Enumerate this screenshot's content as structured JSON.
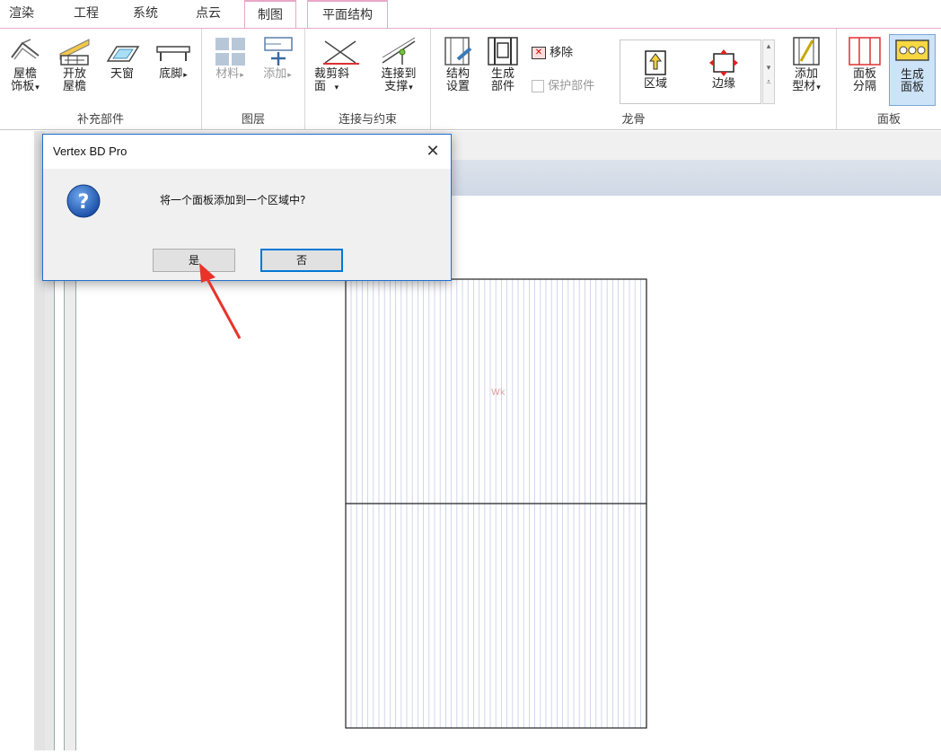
{
  "tabs": [
    "渲染",
    "工程",
    "系统",
    "点云",
    "制图",
    "平面结构"
  ],
  "active_tab": "平面结构",
  "ribbon": {
    "supplement": {
      "label": "补充部件",
      "eave_trim": [
        "屋檐",
        "饰板"
      ],
      "open_eave": [
        "开放",
        "屋檐"
      ],
      "skylight": "天窗",
      "footing": "底脚"
    },
    "layer": {
      "label": "图层",
      "material": "材料",
      "add": "添加"
    },
    "connect": {
      "label": "连接与约束",
      "cut_miter": [
        "裁剪斜",
        "面"
      ],
      "connect_support": [
        "连接到",
        "支撑"
      ]
    },
    "frame": {
      "label": "龙骨",
      "structure_settings": [
        "结构",
        "设置"
      ],
      "generate_parts": [
        "生成",
        "部件"
      ],
      "remove": "移除",
      "protect_parts": "保护部件",
      "region": "区域",
      "edge": "边缘",
      "add_profile": [
        "添加",
        "型材"
      ]
    },
    "panel": {
      "label": "面板",
      "panel_split": [
        "面板",
        "分隔"
      ],
      "generate_panel": [
        "生成",
        "面板"
      ]
    }
  },
  "dialog": {
    "title": "Vertex BD Pro",
    "message": "将一个面板添加到一个区域中?",
    "yes": "是",
    "no": "否",
    "close_glyph": "✕"
  },
  "canvas": {
    "label_text": "Wk"
  },
  "colors": {
    "tab_accent": "#e8a8c8",
    "dialog_border": "#1e6fd0",
    "arrow": "#e8332a",
    "stud_lines": "#c9cbe8"
  }
}
